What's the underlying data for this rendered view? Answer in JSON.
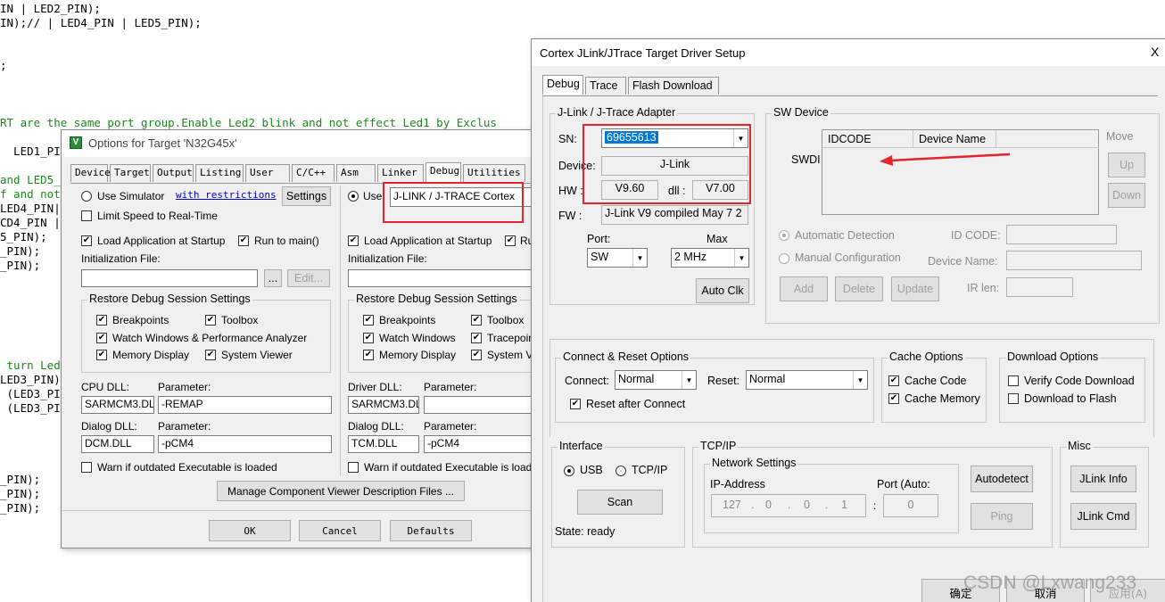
{
  "code_lines": [
    {
      "text": "IN | LED2_PIN);",
      "green": false
    },
    {
      "text": "IN);// | LED4_PIN | LED5_PIN);",
      "green": false
    },
    {
      "text": ";",
      "green": false
    },
    {
      "text": "RT are the same port group.Enable Led2 blink and not effect Led1 by Exclus",
      "green": true
    },
    {
      "text": "  LED1_PI",
      "green": false
    },
    {
      "text": "and LED5_",
      "green": true
    },
    {
      "text": "f and not",
      "green": true
    },
    {
      "text": "LED4_PIN|",
      "green": false
    },
    {
      "text": "CD4_PIN |",
      "green": false
    },
    {
      "text": "5_PIN);",
      "green": false
    },
    {
      "text": "_PIN);",
      "green": false
    },
    {
      "text": "_PIN);",
      "green": false
    },
    {
      "text": " turn Led",
      "green": true
    },
    {
      "text": "LED3_PIN)",
      "green": false
    },
    {
      "text": " (LED3_PI",
      "green": false
    },
    {
      "text": " (LED3_PI",
      "green": false
    },
    {
      "text": "_PIN);",
      "green": false
    },
    {
      "text": "_PIN);",
      "green": false
    },
    {
      "text": "_PIN);",
      "green": false
    }
  ],
  "options": {
    "title": "Options for Target 'N32G45x'",
    "tabs": [
      "Device",
      "Target",
      "Output",
      "Listing",
      "User",
      "C/C++",
      "Asm",
      "Linker",
      "Debug",
      "Utilities"
    ],
    "active_tab": "Debug",
    "use_simulator": "Use Simulator",
    "with_restrictions": "with restrictions",
    "settings": "Settings",
    "limit_speed": "Limit Speed to Real-Time",
    "use": "Use",
    "debugger": "J-LINK / J-TRACE Cortex",
    "load_app": "Load Application at Startup",
    "run_to_main": "Run to main()",
    "run_short": "Ru",
    "init_file": "Initialization File:",
    "browse": "...",
    "edit": "Edit...",
    "restore": "Restore Debug Session Settings",
    "breakpoints": "Breakpoints",
    "toolbox": "Toolbox",
    "watch_perf": "Watch Windows & Performance Analyzer",
    "watch_windows": "Watch Windows",
    "tracepoints": "Tracepoints",
    "memory_display": "Memory Display",
    "system_viewer": "System Viewer",
    "system_short": "System Vie",
    "cpu_dll": "CPU DLL:",
    "driver_dll": "Driver DLL:",
    "parameter": "Parameter:",
    "cpu_dll_val": "SARMCM3.DLL",
    "cpu_param": "-REMAP",
    "driver_dll_val": "SARMCM3.DLL",
    "dialog_dll": "Dialog DLL:",
    "dcm": "DCM.DLL",
    "tcm": "TCM.DLL",
    "pcm4": "-pCM4",
    "warn": "Warn if outdated Executable is loaded",
    "manage": "Manage Component Viewer Description Files ...",
    "ok": "OK",
    "cancel": "Cancel",
    "defaults": "Defaults"
  },
  "jlink": {
    "title": "Cortex JLink/JTrace Target Driver Setup",
    "close": "X",
    "tabs": [
      "Debug",
      "Trace",
      "Flash Download"
    ],
    "adapter_group": "J-Link / J-Trace Adapter",
    "sn_label": "SN:",
    "sn_value": "69655613",
    "device_label": "Device:",
    "device_value": "J-Link",
    "hw_label": "HW :",
    "hw_value": "V9.60",
    "dll_label": "dll :",
    "dll_value": "V7.00",
    "fw_label": "FW :",
    "fw_value": "J-Link V9 compiled May  7 2",
    "port_label": "Port:",
    "port_value": "SW",
    "max_label": "Max",
    "max_value": "2 MHz",
    "auto_clk": "Auto Clk",
    "sw_group": "SW Device",
    "swdi": "SWDI",
    "col_idcode": "IDCODE",
    "col_device": "Device Name",
    "move": "Move",
    "up": "Up",
    "down": "Down",
    "auto_detect": "Automatic Detection",
    "manual_cfg": "Manual Configuration",
    "id_code": "ID CODE:",
    "device_name": "Device Name:",
    "ir_len": "IR len:",
    "add": "Add",
    "delete": "Delete",
    "update": "Update",
    "connect_group": "Connect & Reset Options",
    "connect_label": "Connect:",
    "connect_value": "Normal",
    "reset_label": "Reset:",
    "reset_value": "Normal",
    "reset_after": "Reset after Connect",
    "cache_group": "Cache Options",
    "cache_code": "Cache Code",
    "cache_memory": "Cache Memory",
    "download_group": "Download Options",
    "verify": "Verify Code Download",
    "dl_flash": "Download to Flash",
    "interface_group": "Interface",
    "usb": "USB",
    "tcpip_opt": "TCP/IP",
    "scan": "Scan",
    "state": "State: ready",
    "tcpip_group": "TCP/IP",
    "net_group": "Network Settings",
    "ip_label": "IP-Address",
    "ip": [
      "127",
      "0",
      "0",
      "1"
    ],
    "port_auto": "Port (Auto:",
    "port_num": "0",
    "autodetect": "Autodetect",
    "ping": "Ping",
    "misc_group": "Misc",
    "jlink_info": "JLink Info",
    "jlink_cmd": "JLink Cmd",
    "ok_cn": "确定",
    "cancel_cn": "取消",
    "apply_cn": "应用(A)"
  },
  "watermark": "CSDN @Lxwang233"
}
